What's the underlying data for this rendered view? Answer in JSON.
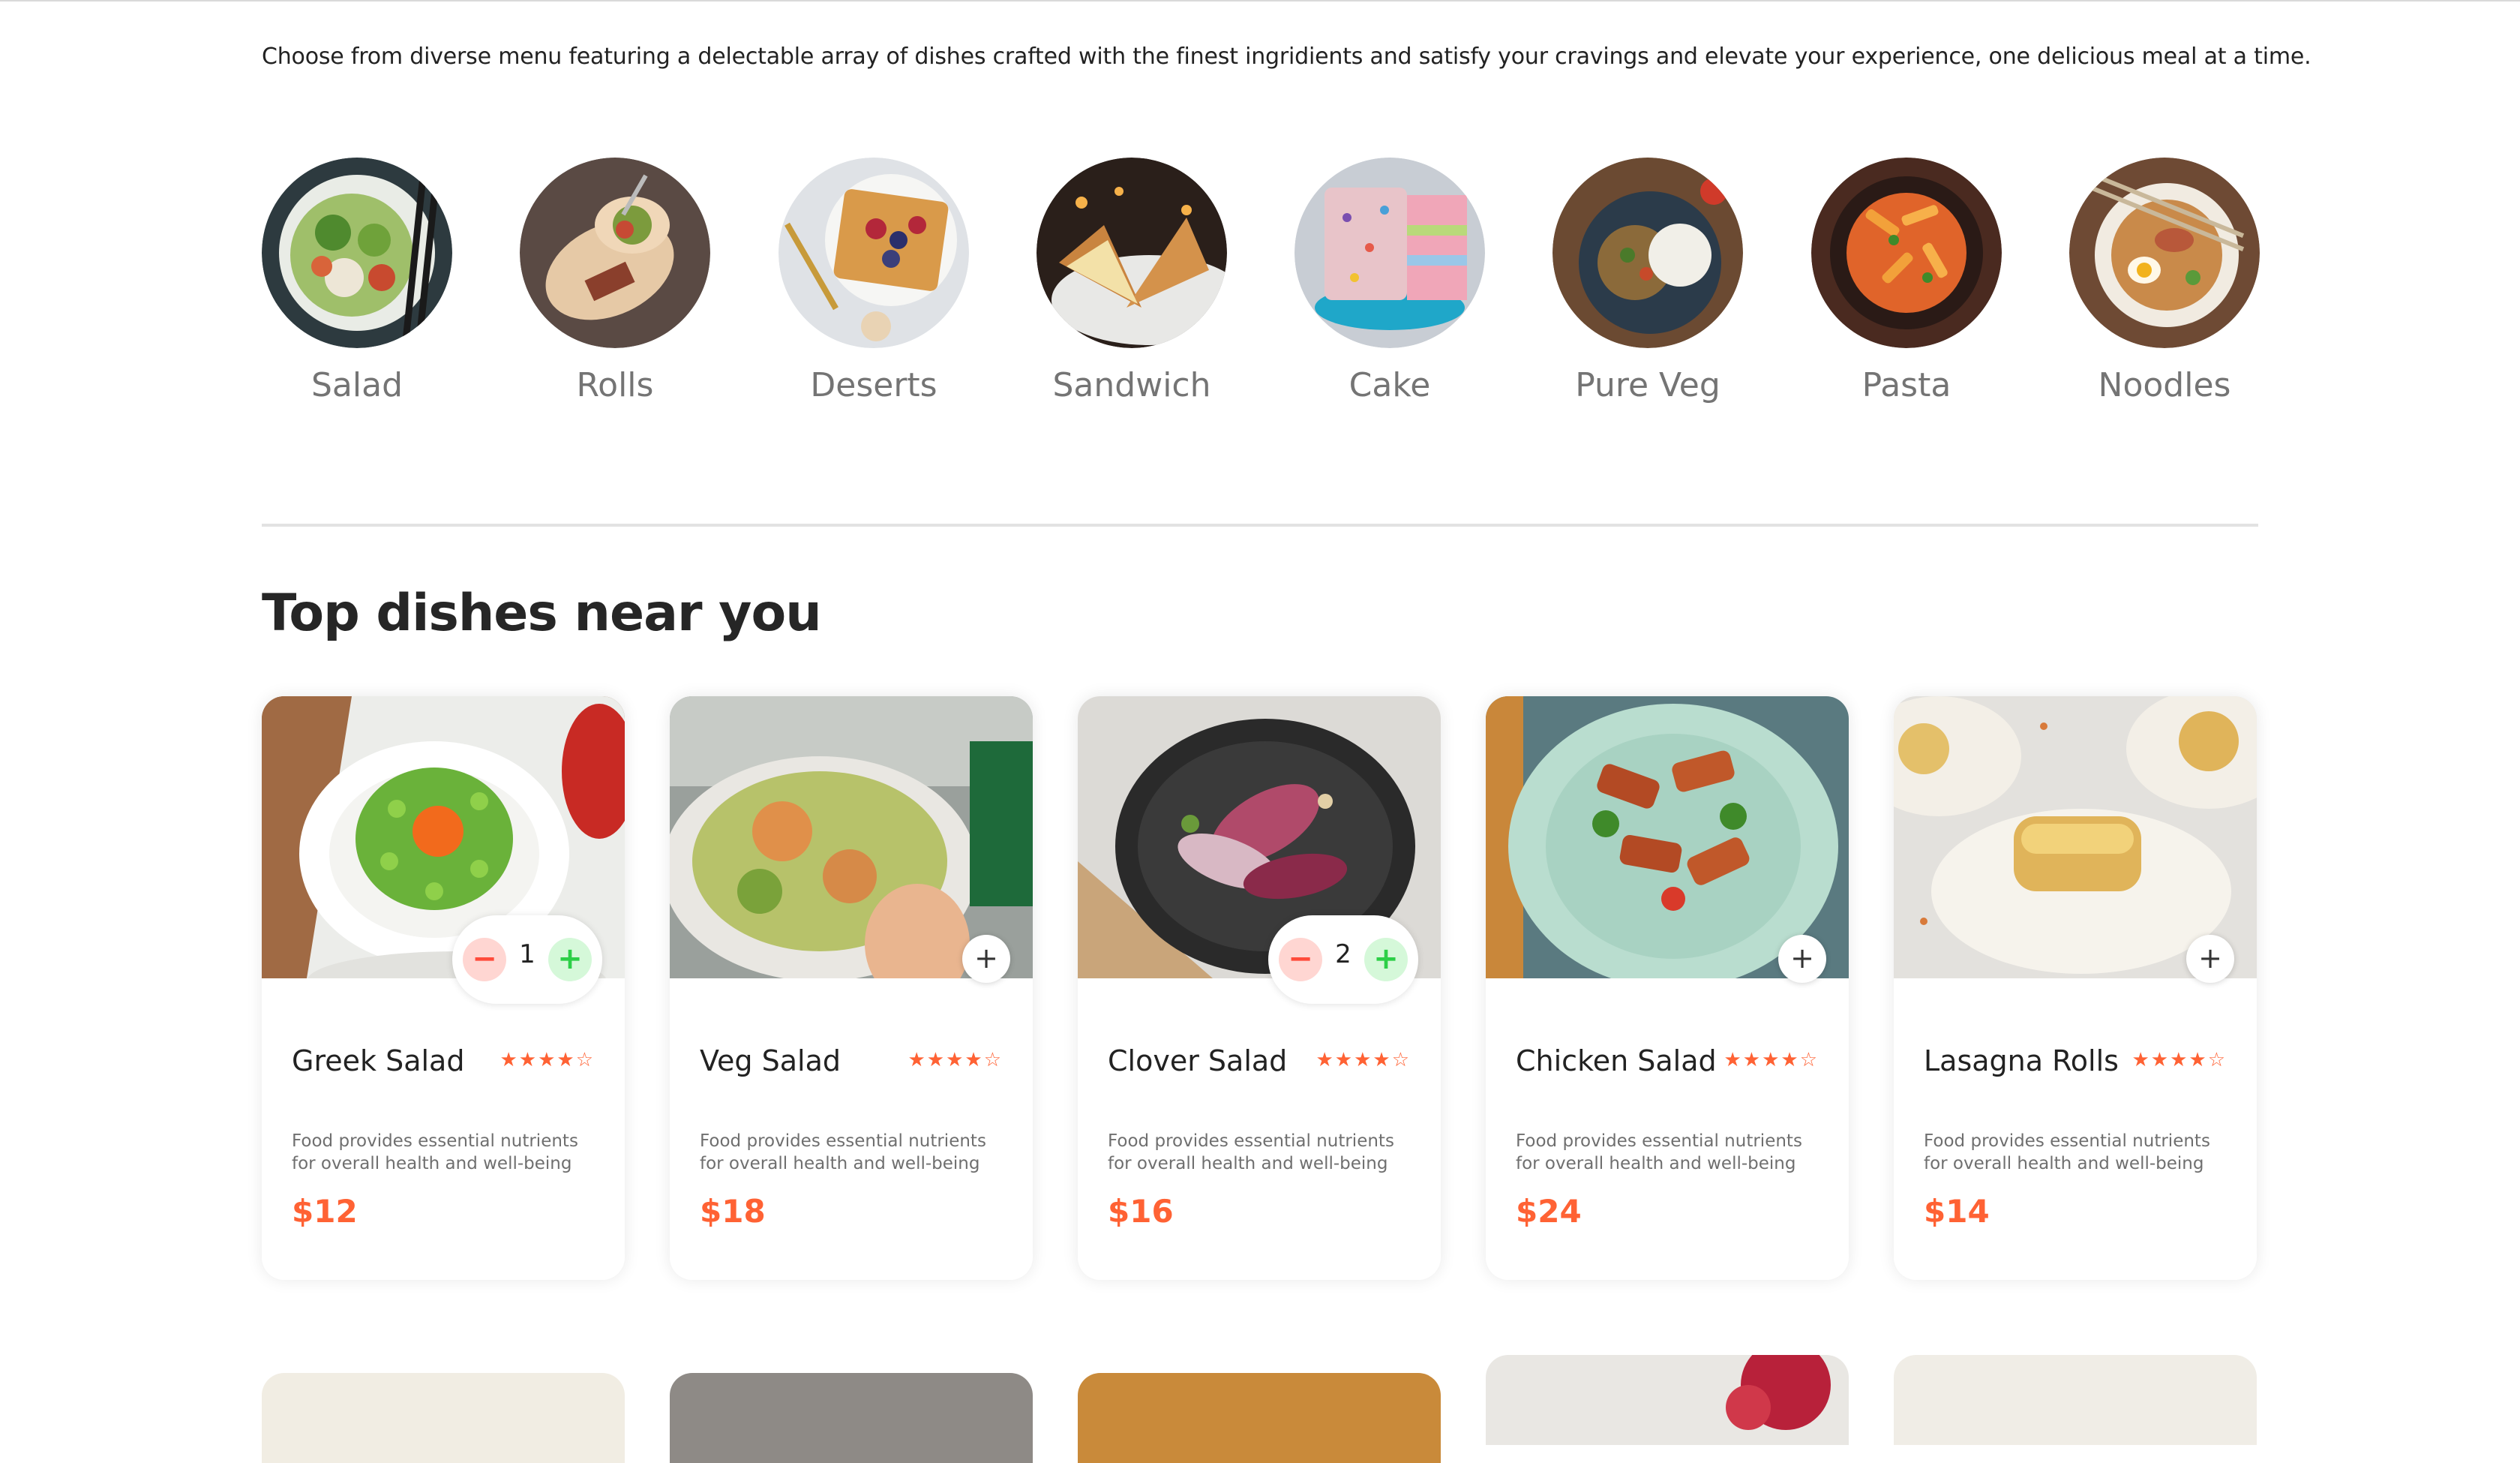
{
  "intro": "Choose from diverse menu featuring a delectable array of dishes crafted with the finest ingridients and satisfy your cravings and elevate your experience, one delicious meal at a time.",
  "categories": [
    {
      "label": "Salad"
    },
    {
      "label": "Rolls"
    },
    {
      "label": "Deserts"
    },
    {
      "label": "Sandwich"
    },
    {
      "label": "Cake"
    },
    {
      "label": "Pure Veg"
    },
    {
      "label": "Pasta"
    },
    {
      "label": "Noodles"
    }
  ],
  "section_title": "Top dishes near you",
  "dishes": [
    {
      "name": "Greek Salad",
      "rating": "★★★★☆",
      "desc": "Food provides essential nutrients for overall health and well-being",
      "price": "$12",
      "quantity": "1"
    },
    {
      "name": "Veg Salad",
      "rating": "★★★★☆",
      "desc": "Food provides essential nutrients for overall health and well-being",
      "price": "$18"
    },
    {
      "name": "Clover Salad",
      "rating": "★★★★☆",
      "desc": "Food provides essential nutrients for overall health and well-being",
      "price": "$16",
      "quantity": "2"
    },
    {
      "name": "Chicken Salad",
      "rating": "★★★★☆",
      "desc": "Food provides essential nutrients for overall health and well-being",
      "price": "$24"
    },
    {
      "name": "Lasagna Rolls",
      "rating": "★★★★☆",
      "desc": "Food provides essential nutrients for overall health and well-being",
      "price": "$14"
    }
  ],
  "controls": {
    "add": "+",
    "minus": "−",
    "plus": "+"
  },
  "colors": {
    "accent": "#ff6234",
    "minus_bg": "#ffd6d2",
    "plus_bg": "#d5f8d9"
  }
}
